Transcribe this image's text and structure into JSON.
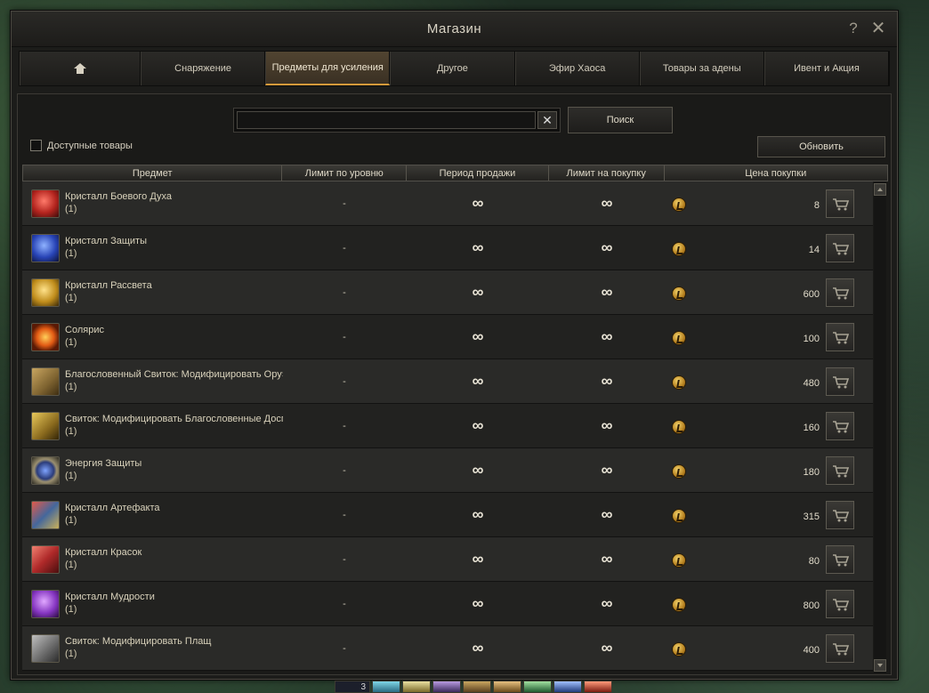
{
  "window": {
    "title": "Магазин",
    "help_label": "?",
    "close_label": "✕"
  },
  "tabs": [
    {
      "label": ""
    },
    {
      "label": "Снаряжение"
    },
    {
      "label": "Предметы для усиления"
    },
    {
      "label": "Другое"
    },
    {
      "label": "Эфир Хаоса"
    },
    {
      "label": "Товары за адены"
    },
    {
      "label": "Ивент и Акция"
    }
  ],
  "active_tab": "Предметы для усиления",
  "search": {
    "value": "",
    "placeholder": "",
    "clear_label": "✕",
    "button_label": "Поиск"
  },
  "filters": {
    "available_label": "Доступные товары",
    "available_checked": false
  },
  "refresh_label": "Обновить",
  "table": {
    "headers": [
      "Предмет",
      "Лимит по уровню",
      "Период продажи",
      "Лимит на покупку",
      "Цена покупки"
    ],
    "rows": [
      {
        "icon": "red-crystal-icon",
        "name": "Кристалл Боевого Духа",
        "qty": "(1)",
        "level": "-",
        "period": "∞",
        "limit": "∞",
        "price": "8"
      },
      {
        "icon": "blue-crystal-icon",
        "name": "Кристалл Защиты",
        "qty": "(1)",
        "level": "-",
        "period": "∞",
        "limit": "∞",
        "price": "14"
      },
      {
        "icon": "gold-crystal-icon",
        "name": "Кристалл Рассвета",
        "qty": "(1)",
        "level": "-",
        "period": "∞",
        "limit": "∞",
        "price": "600"
      },
      {
        "icon": "sun-orb-icon",
        "name": "Солярис",
        "qty": "(1)",
        "level": "-",
        "period": "∞",
        "limit": "∞",
        "price": "100"
      },
      {
        "icon": "scroll-icon",
        "name": "Благословенный Свиток: Модифицировать Ору»",
        "qty": "(1)",
        "level": "-",
        "period": "∞",
        "limit": "∞",
        "price": "480"
      },
      {
        "icon": "gold-scroll-icon",
        "name": "Свиток: Модифицировать Благословенные Досп",
        "qty": "(1)",
        "level": "-",
        "period": "∞",
        "limit": "∞",
        "price": "160"
      },
      {
        "icon": "energy-orb-icon",
        "name": "Энергия Защиты",
        "qty": "(1)",
        "level": "-",
        "period": "∞",
        "limit": "∞",
        "price": "180"
      },
      {
        "icon": "artifact-crystal-icon",
        "name": "Кристалл Артефакта",
        "qty": "(1)",
        "level": "-",
        "period": "∞",
        "limit": "∞",
        "price": "315"
      },
      {
        "icon": "paint-crystal-icon",
        "name": "Кристалл Красок",
        "qty": "(1)",
        "level": "-",
        "period": "∞",
        "limit": "∞",
        "price": "80"
      },
      {
        "icon": "purple-crystal-icon",
        "name": "Кристалл Мудрости",
        "qty": "(1)",
        "level": "-",
        "period": "∞",
        "limit": "∞",
        "price": "800"
      },
      {
        "icon": "cloak-scroll-icon",
        "name": "Свиток: Модифицировать Плащ",
        "qty": "(1)",
        "level": "-",
        "period": "∞",
        "limit": "∞",
        "price": "400"
      }
    ]
  },
  "hotbar": {
    "number": "3"
  },
  "colors": {
    "accent": "#d59a3a",
    "panel": "#1c1c1a",
    "text": "#d9d2bb"
  }
}
